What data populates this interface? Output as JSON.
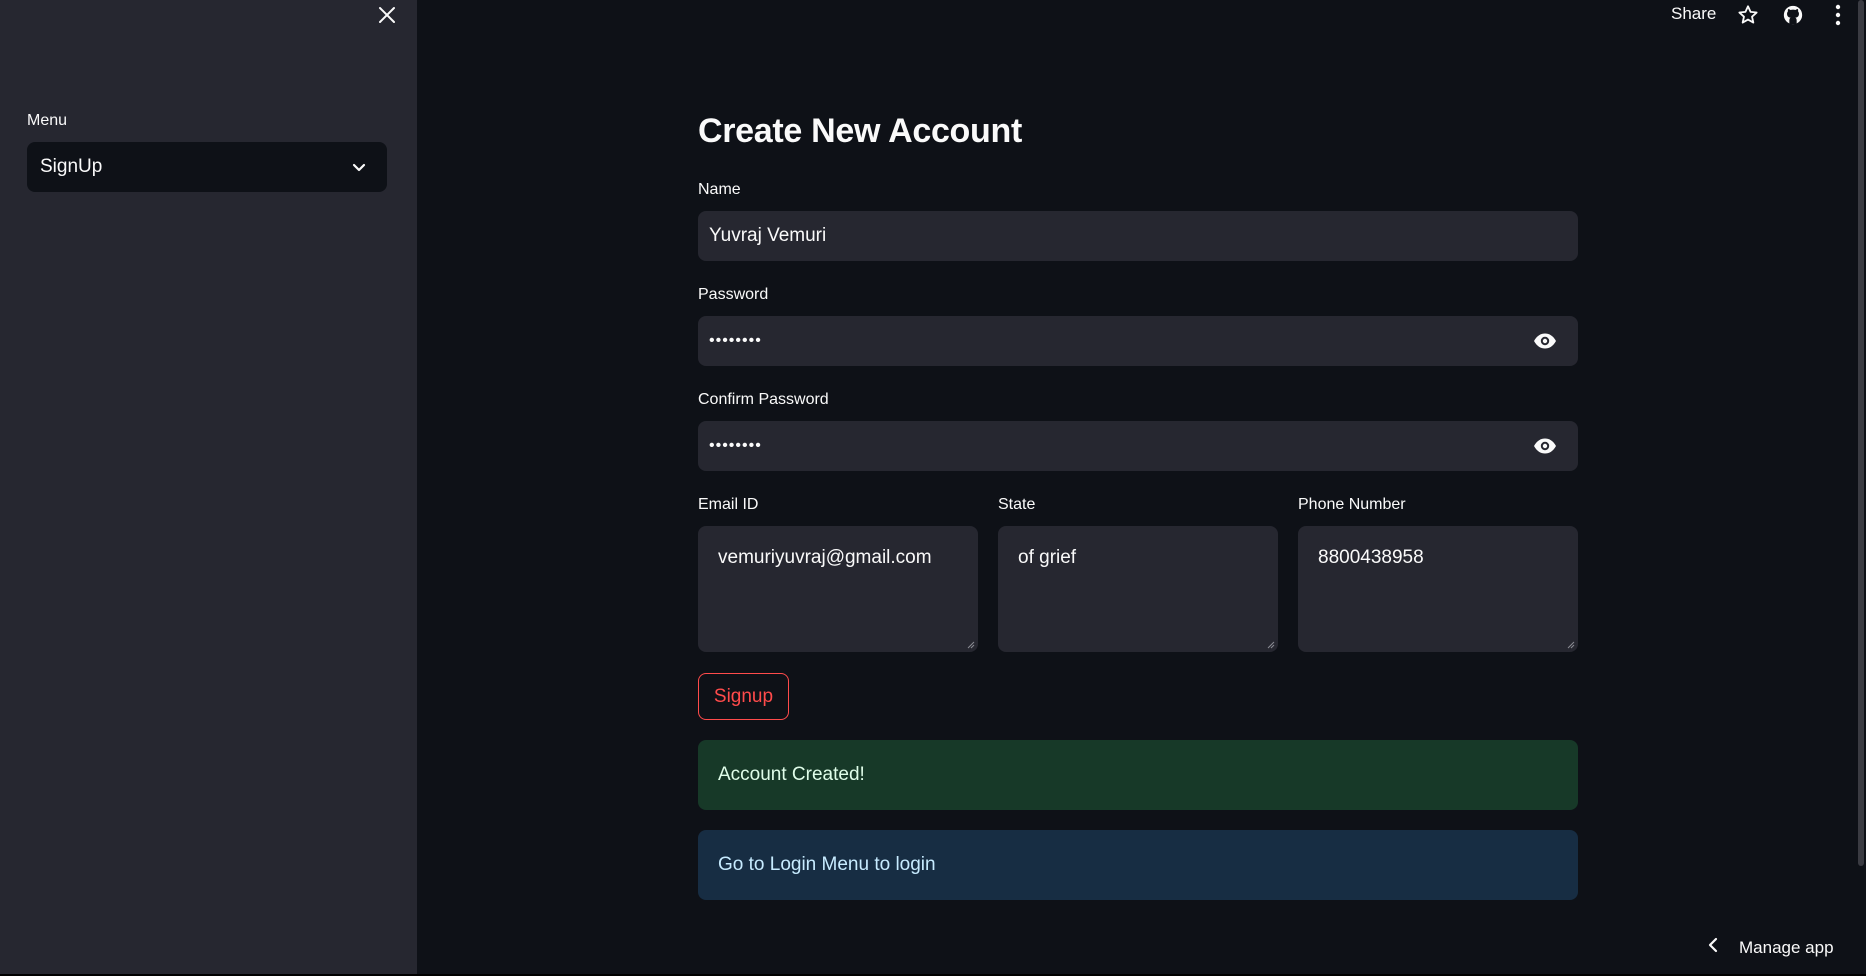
{
  "sidebar": {
    "close_icon": "close-icon",
    "menu_label": "Menu",
    "menu_selected": "SignUp",
    "menu_icon": "chevron-down-icon"
  },
  "header": {
    "share_label": "Share",
    "icons": [
      "star-icon",
      "github-icon",
      "more-vertical-icon"
    ]
  },
  "main": {
    "title": "Create New Account",
    "name": {
      "label": "Name",
      "value": "Yuvraj Vemuri"
    },
    "password": {
      "label": "Password",
      "value": "••••••••"
    },
    "confirm_password": {
      "label": "Confirm Password",
      "value": "••••••••"
    },
    "email": {
      "label": "Email ID",
      "value": "vemuriyuvraj@gmail.com"
    },
    "state": {
      "label": "State",
      "value": "of grief"
    },
    "phone": {
      "label": "Phone Number",
      "value": "8800438958"
    },
    "signup_button": "Signup",
    "success_message": "Account Created!",
    "info_message": "Go to Login Menu to login"
  },
  "footer": {
    "manage_app_label": "Manage app"
  },
  "colors": {
    "background": "#0e1117",
    "sidebar": "#262730",
    "primary": "#ff4b4b",
    "success_bg": "#173928",
    "info_bg": "#172d43"
  }
}
